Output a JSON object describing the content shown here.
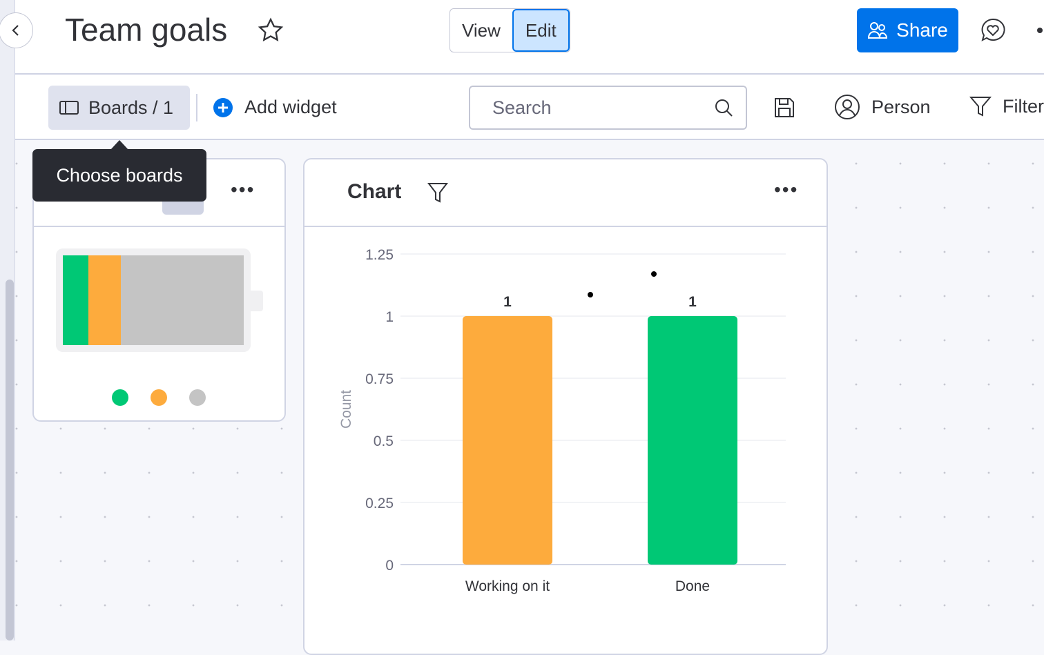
{
  "header": {
    "title": "Team goals",
    "view_label": "View",
    "edit_label": "Edit",
    "share_label": "Share"
  },
  "toolbar": {
    "boards_label": "Boards / 1",
    "add_widget_label": "Add widget",
    "search_placeholder": "Search",
    "person_label": "Person",
    "filter_label": "Filter"
  },
  "tooltip": {
    "text": "Choose boards"
  },
  "battery_widget": {
    "segments": [
      {
        "color": "#00c875",
        "fraction": 0.14
      },
      {
        "color": "#fdab3d",
        "fraction": 0.18
      },
      {
        "color": "#c4c4c4",
        "fraction": 0.68
      }
    ],
    "legend_colors": [
      "#00c875",
      "#fdab3d",
      "#c4c4c4"
    ]
  },
  "chart_widget": {
    "title": "Chart"
  },
  "chart_data": {
    "type": "bar",
    "categories": [
      "Working on it",
      "Done"
    ],
    "values": [
      1,
      1
    ],
    "colors": [
      "#fdab3d",
      "#00c875"
    ],
    "ylabel": "Count",
    "ylim": [
      0,
      1.25
    ],
    "yticks": [
      "0",
      "0.25",
      "0.5",
      "0.75",
      "1",
      "1.25"
    ],
    "data_labels": [
      "1",
      "1"
    ],
    "grid": true
  },
  "colors": {
    "accent": "#0073ea"
  }
}
